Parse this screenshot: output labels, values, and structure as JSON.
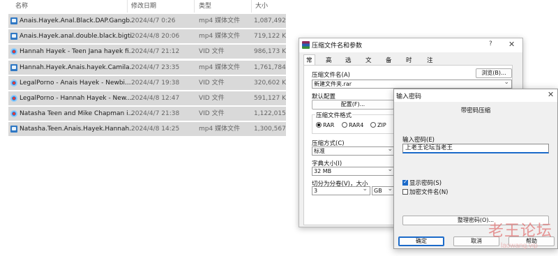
{
  "explorer": {
    "columns": {
      "name": "名称",
      "date": "修改日期",
      "type": "类型",
      "size": "大小"
    },
    "files": [
      {
        "name": "Anais.Hayek.Anal.Black.DAP.Gangb...",
        "date": "2024/4/7 0:26",
        "type": "mp4 媒体文件",
        "size": "1,087,492...",
        "icon": "mp4-file-icon"
      },
      {
        "name": "Anais.Hayek.anal.double.black.bigti...",
        "date": "2024/4/8 20:06",
        "type": "mp4 媒体文件",
        "size": "719,122 KB",
        "icon": "mp4-file-icon"
      },
      {
        "name": "Hannah Hayek - Teen Jana hayek fi...",
        "date": "2024/4/7 21:12",
        "type": "VID 文件",
        "size": "986,173 KB",
        "icon": "vid-file-icon"
      },
      {
        "name": "Hannah.Hayek.Anais.hayek.Camila....",
        "date": "2024/4/7 23:35",
        "type": "mp4 媒体文件",
        "size": "1,761,784...",
        "icon": "mp4-file-icon"
      },
      {
        "name": "LegalPorno - Anais Hayek - Newbi...",
        "date": "2024/4/7 19:38",
        "type": "VID 文件",
        "size": "320,602 KB",
        "icon": "vid-file-icon"
      },
      {
        "name": "LegalPorno - Hannah Hayek - New...",
        "date": "2024/4/8 12:47",
        "type": "VID 文件",
        "size": "591,127 KB",
        "icon": "vid-file-icon"
      },
      {
        "name": "Natasha Teen and Mike Chapman i...",
        "date": "2024/4/7 21:38",
        "type": "VID 文件",
        "size": "1,122,015...",
        "icon": "vid-file-icon"
      },
      {
        "name": "Natasha.Teen.Anais.Hayek.Hannah....",
        "date": "2024/4/8 14:25",
        "type": "mp4 媒体文件",
        "size": "1,300,567...",
        "icon": "mp4-file-icon"
      }
    ]
  },
  "rar_dialog": {
    "title": "压缩文件名和参数",
    "help": "?",
    "close": "✕",
    "tabs": [
      "常规",
      "高级",
      "选项",
      "文件",
      "备份",
      "时间",
      "注释"
    ],
    "archive_name_label": "压缩文件名(A)",
    "browse_button": "浏览(B)...",
    "archive_name_value": "新建文件夹.rar",
    "default_config_label": "默认配置",
    "config_button": "配置(F)...",
    "format_label": "压缩文件格式",
    "formats": [
      "RAR",
      "RAR4",
      "ZIP"
    ],
    "format_selected": "RAR",
    "method_label": "压缩方式(C)",
    "method_value": "标准",
    "dict_label": "字典大小(I)",
    "dict_value": "32 MB",
    "split_label": "切分为分卷(V)，大小",
    "split_value": "3",
    "split_unit": "GB"
  },
  "password_dialog": {
    "title": "输入密码",
    "close": "✕",
    "subtitle": "带密码压缩",
    "input_label": "输入密码(E)",
    "input_value": "上老王论坛当老王",
    "show_password": "显示密码(S)",
    "show_password_checked": true,
    "encrypt_names": "加密文件名(N)",
    "encrypt_names_checked": false,
    "organize_button": "整理密码(O)...",
    "ok_button": "确定",
    "cancel_button": "取消",
    "help_button": "帮助"
  },
  "watermark": {
    "title": "老王论坛",
    "url": "laowang.vip"
  },
  "colors": {
    "row_selected": "#d9d9d9",
    "accent": "#1b6ac9",
    "watermark": "#e27575"
  }
}
